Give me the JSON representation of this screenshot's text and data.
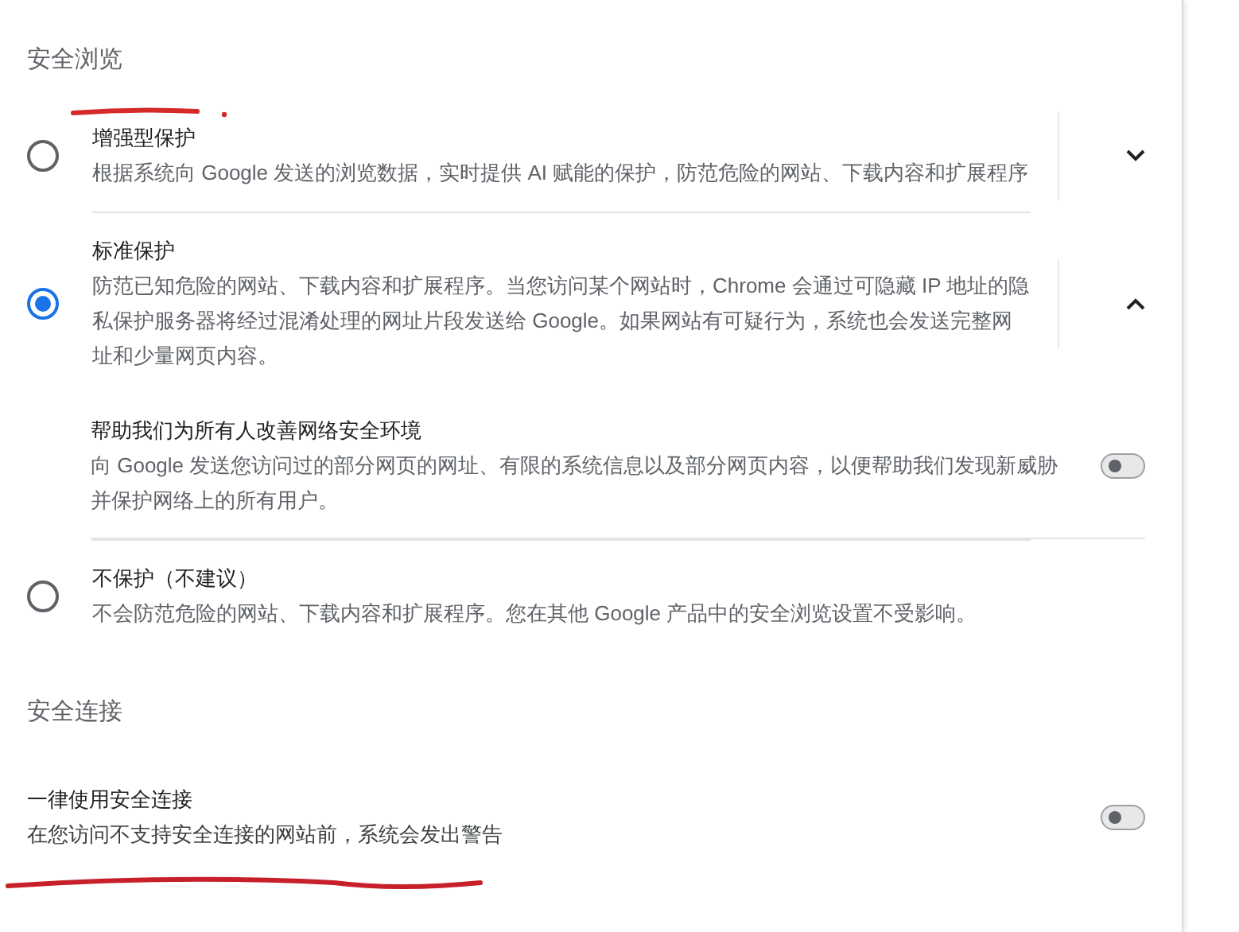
{
  "sections": [
    {
      "title": "安全浏览",
      "items": [
        {
          "kind": "radio",
          "label": "增强型保护",
          "description": "根据系统向 Google 发送的浏览数据，实时提供 AI 赋能的保护，防范危险的网站、下载内容和扩展程序",
          "selected": false,
          "expanded": false
        },
        {
          "kind": "radio",
          "label": "标准保护",
          "description": "防范已知危险的网站、下载内容和扩展程序。当您访问某个网站时，Chrome 会通过可隐藏 IP 地址的隐私保护服务器将经过混淆处理的网址片段发送给 Google。如果网站有可疑行为，系统也会发送完整网址和少量网页内容。",
          "selected": true,
          "expanded": true,
          "children": [
            {
              "kind": "toggle",
              "label": "帮助我们为所有人改善网络安全环境",
              "description": "向 Google 发送您访问过的部分网页的网址、有限的系统信息以及部分网页内容，以便帮助我们发现新威胁并保护网络上的所有用户。",
              "on": false
            }
          ]
        },
        {
          "kind": "radio",
          "label": "不保护（不建议）",
          "description": "不会防范危险的网站、下载内容和扩展程序。您在其他 Google 产品中的安全浏览设置不受影响。",
          "selected": false
        }
      ]
    },
    {
      "title": "安全连接",
      "items": [
        {
          "kind": "toggle",
          "label": "一律使用安全连接",
          "description": "在您访问不支持安全连接的网站前，系统会发出警告",
          "on": false
        }
      ]
    }
  ]
}
